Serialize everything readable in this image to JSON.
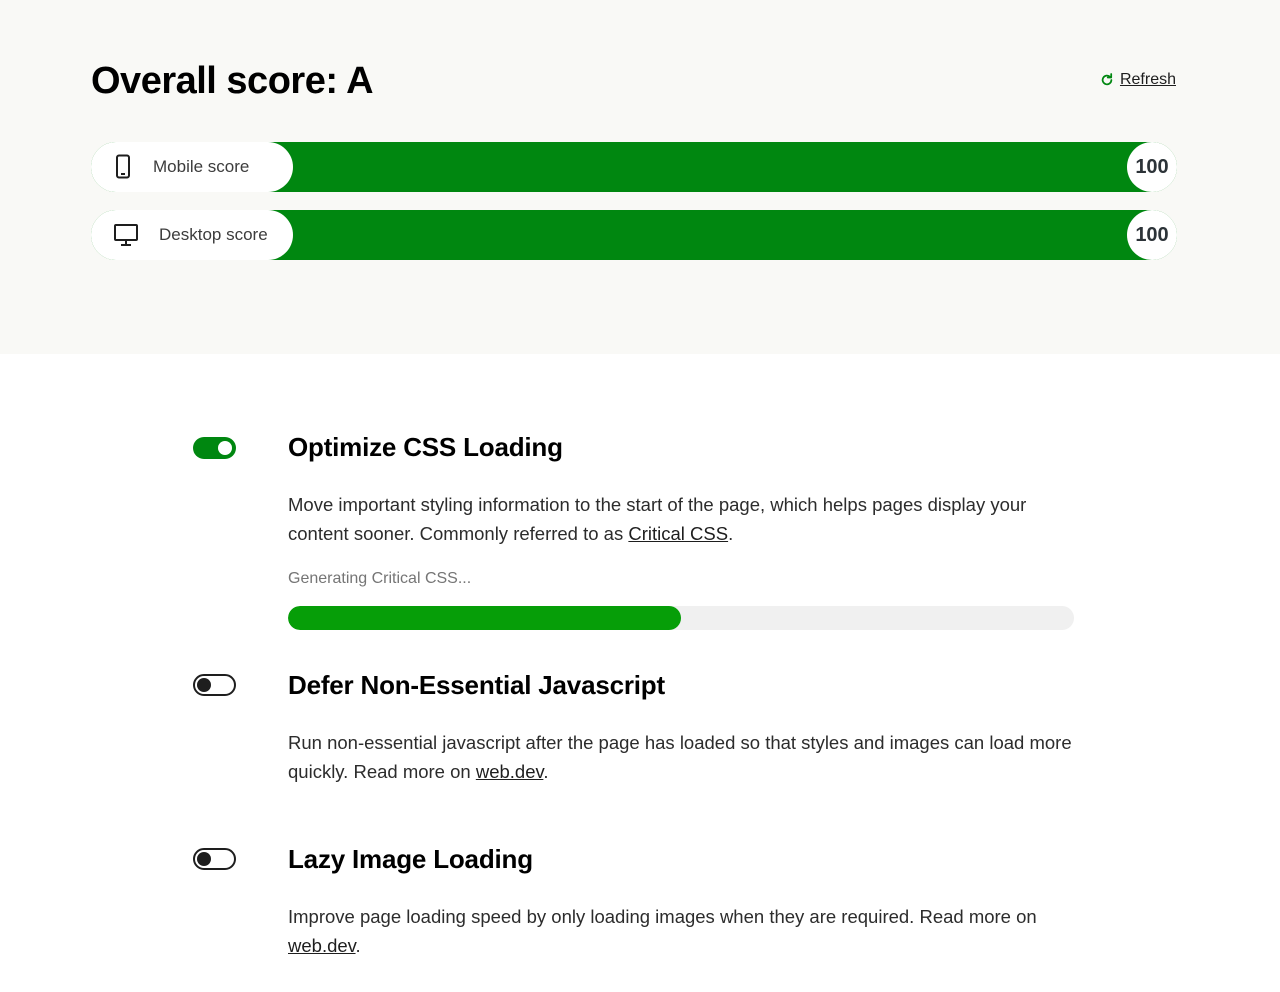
{
  "header": {
    "title": "Overall score: A",
    "refresh_label": "Refresh"
  },
  "scores": [
    {
      "key": "mobile",
      "label": "Mobile score",
      "value": "100",
      "fraction": 1.0,
      "icon": "mobile-phone-icon"
    },
    {
      "key": "desktop",
      "label": "Desktop score",
      "value": "100",
      "fraction": 1.0,
      "icon": "desktop-monitor-icon"
    }
  ],
  "modules": [
    {
      "title": "Optimize CSS Loading",
      "enabled": true,
      "desc_before": "Move important styling information to the start of the page, which helps pages display your content sooner. Commonly referred to as ",
      "link": "Critical CSS",
      "desc_after": ".",
      "progress_label": "Generating Critical CSS...",
      "progress": 0.5
    },
    {
      "title": "Defer Non-Essential Javascript",
      "enabled": false,
      "desc_before": "Run non-essential javascript after the page has loaded so that styles and images can load more quickly. Read more on ",
      "link": "web.dev",
      "desc_after": "."
    },
    {
      "title": "Lazy Image Loading",
      "enabled": false,
      "desc_before": "Improve page loading speed by only loading images when they are required. Read more on ",
      "link": "web.dev",
      "desc_after": "."
    }
  ],
  "colors": {
    "score_good": "#008710",
    "progress": "#069e08",
    "toggle_on": "#008710"
  }
}
